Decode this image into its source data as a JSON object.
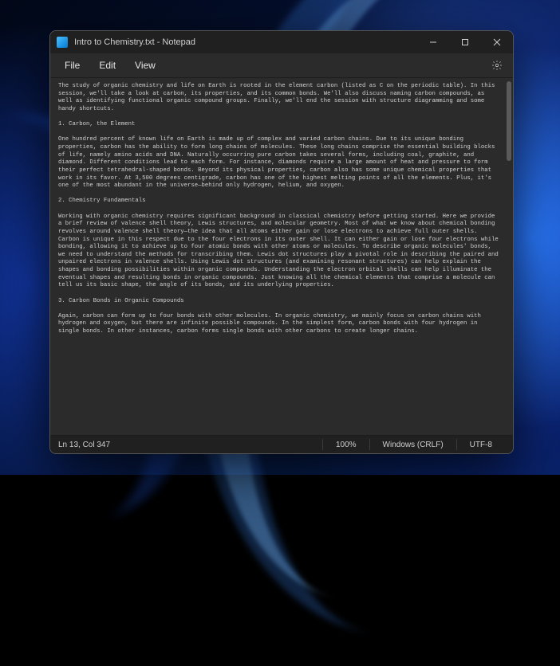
{
  "titlebar": {
    "title": "Intro to Chemistry.txt - Notepad"
  },
  "menu": {
    "file": "File",
    "edit": "Edit",
    "view": "View"
  },
  "document": {
    "p_intro": "The study of organic chemistry and life on Earth is rooted in the element carbon (listed as C on the periodic table). In this session, we'll take a look at carbon, its properties, and its common bonds. We'll also discuss naming carbon compounds, as well as identifying functional organic compound groups. Finally, we'll end the session with structure diagramming and some handy shortcuts.",
    "h1": "1. Carbon, the Element",
    "p1": "One hundred percent of known life on Earth is made up of complex and varied carbon chains. Due to its unique bonding properties, carbon has the ability to form long chains of molecules. These long chains comprise the essential building blocks of life, namely amino acids and DNA. Naturally occurring pure carbon takes several forms, including coal, graphite, and diamond. Different conditions lead to each form. For instance, diamonds require a large amount of heat and pressure to form their perfect tetrahedral-shaped bonds. Beyond its physical properties, carbon also has some unique chemical properties that work in its favor. At 3,500 degrees centigrade, carbon has one of the highest melting points of all the elements. Plus, it's one of the most abundant in the universe—behind only hydrogen, helium, and oxygen.",
    "h2": "2. Chemistry Fundamentals",
    "p2": "Working with organic chemistry requires significant background in classical chemistry before getting started. Here we provide a brief review of valence shell theory, Lewis structures, and molecular geometry. Most of what we know about chemical bonding revolves around valence shell theory—the idea that all atoms either gain or lose electrons to achieve full outer shells. Carbon is unique in this respect due to the four electrons in its outer shell. It can either gain or lose four electrons while bonding, allowing it to achieve up to four atomic bonds with other atoms or molecules. To describe organic molecules' bonds, we need to understand the methods for transcribing them. Lewis dot structures play a pivotal role in describing the paired and unpaired electrons in valence shells. Using Lewis dot structures (and examining resonant structures) can help explain the shapes and bonding possibilities within organic compounds. Understanding the electron orbital shells can help illuminate the eventual shapes and resulting bonds in organic compounds. Just knowing all the chemical elements that comprise a molecule can tell us its basic shape, the angle of its bonds, and its underlying properties.",
    "h3": "3. Carbon Bonds in Organic Compounds",
    "p3": "Again, carbon can form up to four bonds with other molecules. In organic chemistry, we mainly focus on carbon chains with hydrogen and oxygen, but there are infinite possible compounds. In the simplest form, carbon bonds with four hydrogen in single bonds. In other instances, carbon forms single bonds with other carbons to create longer chains."
  },
  "status": {
    "position": "Ln 13, Col 347",
    "zoom": "100%",
    "line_ending": "Windows (CRLF)",
    "encoding": "UTF-8"
  }
}
